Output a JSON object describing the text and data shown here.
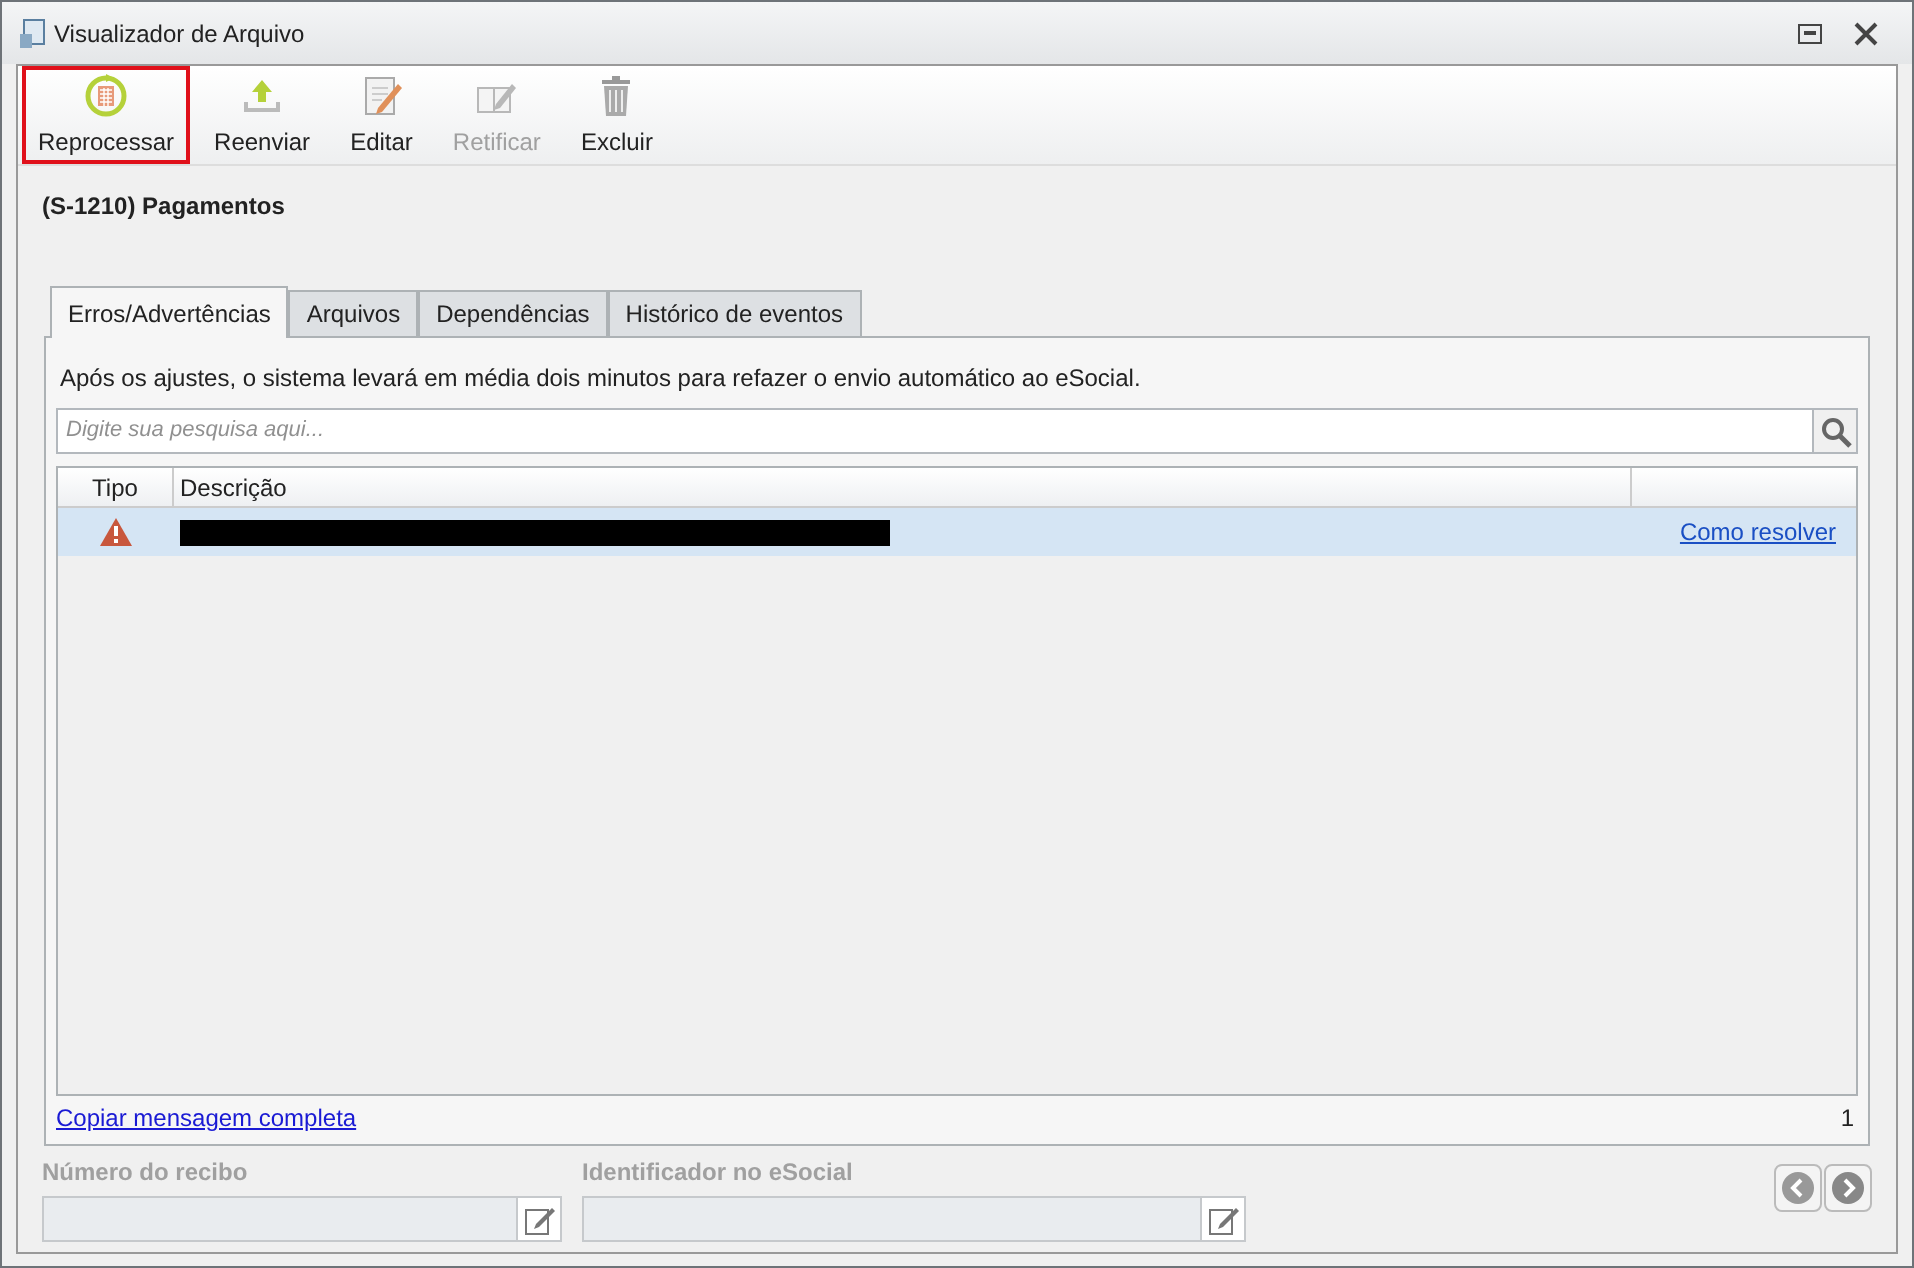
{
  "window": {
    "title": "Visualizador de Arquivo"
  },
  "toolbar": [
    {
      "kind": "reprocess",
      "label": "Reprocessar",
      "disabled": false,
      "highlighted": true
    },
    {
      "kind": "resend",
      "label": "Reenviar",
      "disabled": false,
      "highlighted": false
    },
    {
      "kind": "edit",
      "label": "Editar",
      "disabled": false,
      "highlighted": false
    },
    {
      "kind": "rectify",
      "label": "Retificar",
      "disabled": true,
      "highlighted": false
    },
    {
      "kind": "delete",
      "label": "Excluir",
      "disabled": false,
      "highlighted": false
    }
  ],
  "heading": "(S-1210) Pagamentos",
  "tabs": [
    {
      "label": "Erros/Advertências",
      "selected": true
    },
    {
      "label": "Arquivos",
      "selected": false
    },
    {
      "label": "Dependências",
      "selected": false
    },
    {
      "label": "Histórico de eventos",
      "selected": false
    }
  ],
  "notice": "Após os ajustes, o sistema levará em média dois minutos para refazer o envio automático ao eSocial.",
  "search": {
    "placeholder": "Digite sua pesquisa aqui..."
  },
  "table": {
    "columns": [
      "Tipo",
      "Descrição"
    ],
    "rows": [
      {
        "kind": "warning",
        "description_redacted": true,
        "link": "Como resolver",
        "selected": true
      }
    ]
  },
  "copy_link": "Copiar mensagem completa",
  "count": "1",
  "fields": [
    {
      "label": "Número do recibo"
    },
    {
      "label": "Identificador no eSocial"
    }
  ]
}
